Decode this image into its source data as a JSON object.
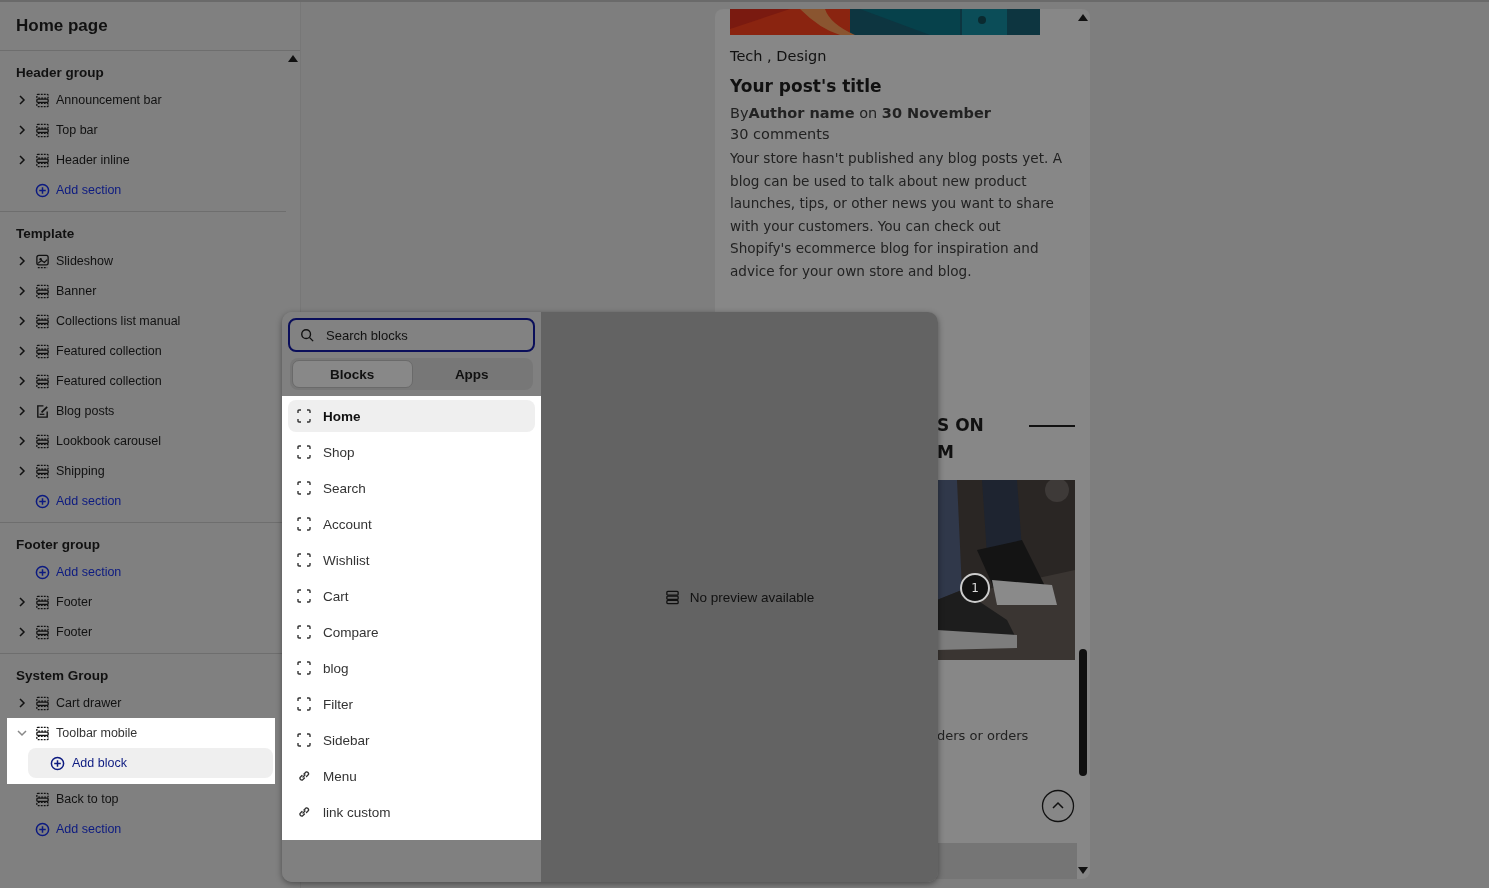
{
  "sidebar": {
    "title": "Home page",
    "groups": [
      {
        "title": "Header group",
        "items": [
          {
            "kind": "section",
            "label": "Announcement bar",
            "expanded": false,
            "selected": false,
            "has_children": true
          },
          {
            "kind": "section",
            "label": "Top bar",
            "expanded": false,
            "selected": false,
            "has_children": true
          },
          {
            "kind": "section",
            "label": "Header inline",
            "expanded": false,
            "selected": false,
            "has_children": true
          },
          {
            "kind": "add",
            "label": "Add section",
            "selected": false
          }
        ]
      },
      {
        "title": "Template",
        "items": [
          {
            "kind": "media",
            "label": "Slideshow",
            "expanded": false,
            "selected": false,
            "has_children": true
          },
          {
            "kind": "section",
            "label": "Banner",
            "expanded": false,
            "selected": false,
            "has_children": true
          },
          {
            "kind": "section",
            "label": "Collections list manual",
            "expanded": false,
            "selected": false,
            "has_children": true
          },
          {
            "kind": "section",
            "label": "Featured collection",
            "expanded": false,
            "selected": false,
            "has_children": true
          },
          {
            "kind": "section",
            "label": "Featured collection",
            "expanded": false,
            "selected": false,
            "has_children": true
          },
          {
            "kind": "post",
            "label": "Blog posts",
            "expanded": false,
            "selected": false,
            "has_children": true
          },
          {
            "kind": "section",
            "label": "Lookbook carousel",
            "expanded": false,
            "selected": false,
            "has_children": true
          },
          {
            "kind": "section",
            "label": "Shipping",
            "expanded": false,
            "selected": false,
            "has_children": true
          },
          {
            "kind": "add",
            "label": "Add section",
            "selected": false
          }
        ]
      },
      {
        "title": "Footer group",
        "items": [
          {
            "kind": "add",
            "label": "Add section",
            "selected": false
          },
          {
            "kind": "section",
            "label": "Footer",
            "expanded": false,
            "selected": false,
            "has_children": true
          },
          {
            "kind": "section",
            "label": "Footer",
            "expanded": false,
            "selected": false,
            "has_children": true
          }
        ]
      },
      {
        "title": "System Group",
        "items": [
          {
            "kind": "section",
            "label": "Cart drawer",
            "expanded": false,
            "selected": false,
            "has_children": true
          },
          {
            "kind": "section",
            "label": "Toolbar mobile",
            "expanded": true,
            "selected": true,
            "has_children": true,
            "children": [
              {
                "kind": "add-block",
                "label": "Add block"
              }
            ]
          },
          {
            "kind": "section",
            "label": "Back to top",
            "expanded": false,
            "selected": false,
            "has_children": false
          },
          {
            "kind": "add",
            "label": "Add section",
            "selected": false
          }
        ]
      }
    ]
  },
  "preview": {
    "tags": "Tech , Design",
    "post_title": "Your post's title",
    "byline": "By**Author name** on **30 November**",
    "comments": "30 comments",
    "body": "Your store hasn't published any blog posts yet. A blog can be used to talk about new product launches, tips, or other news you want to share with your customers. You can check out Shopify's ecommerce blog for inspiration and advice for your own store and blog.",
    "heading_lines": [
      "S ON",
      "M"
    ],
    "hotspot": "1",
    "caption": "ders or orders"
  },
  "block_picker": {
    "search": {
      "placeholder": "Search blocks"
    },
    "tabs": [
      {
        "label": "Blocks",
        "selected": true
      },
      {
        "label": "Apps",
        "selected": false
      }
    ],
    "items": [
      {
        "kind": "block",
        "label": "Home",
        "selected": true
      },
      {
        "kind": "block",
        "label": "Shop",
        "selected": false
      },
      {
        "kind": "block",
        "label": "Search",
        "selected": false
      },
      {
        "kind": "block",
        "label": "Account",
        "selected": false
      },
      {
        "kind": "block",
        "label": "Wishlist",
        "selected": false
      },
      {
        "kind": "block",
        "label": "Cart",
        "selected": false
      },
      {
        "kind": "block",
        "label": "Compare",
        "selected": false
      },
      {
        "kind": "block",
        "label": "blog",
        "selected": false
      },
      {
        "kind": "block",
        "label": "Filter",
        "selected": false
      },
      {
        "kind": "block",
        "label": "Sidebar",
        "selected": false
      },
      {
        "kind": "link",
        "label": "Menu",
        "selected": false
      },
      {
        "kind": "link",
        "label": "link custom",
        "selected": false
      }
    ],
    "preview_text": "No preview available"
  }
}
